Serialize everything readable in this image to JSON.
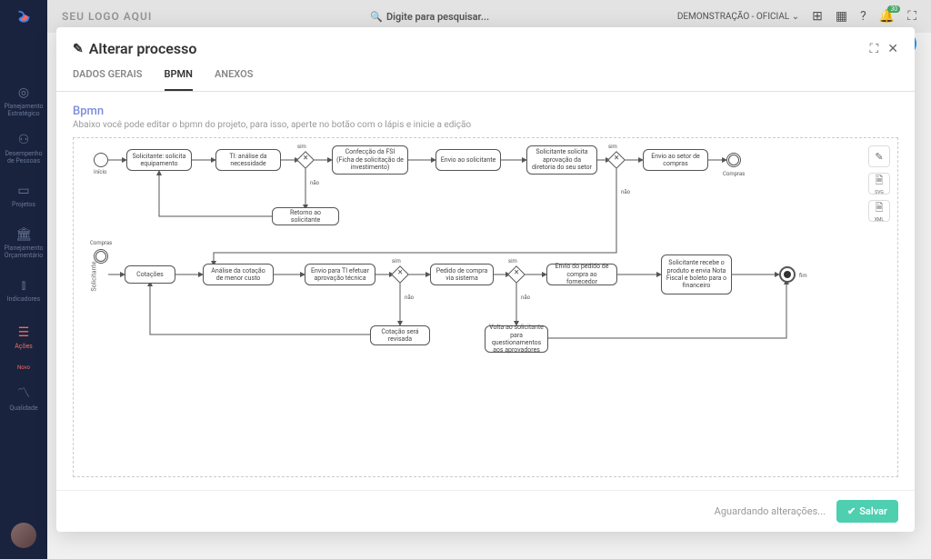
{
  "sidebar": {
    "items": [
      {
        "label": "Planejamento Estratégico"
      },
      {
        "label": "Desempenho de Pessoas"
      },
      {
        "label": "Projetos"
      },
      {
        "label": "Planejamento Orçamentário"
      },
      {
        "label": "Indicadores"
      },
      {
        "label": "Ações"
      },
      {
        "label": "Qualidade"
      }
    ],
    "new_badge": "Novo"
  },
  "header": {
    "logo": "SEU LOGO AQUI",
    "search_placeholder": "Digite para pesquisar...",
    "tenant": "DEMONSTRAÇÃO - OFICIAL",
    "notif_count": "30"
  },
  "modal": {
    "title": "Alterar processo",
    "tabs": [
      {
        "label": "DADOS GERAIS",
        "active": false
      },
      {
        "label": "BPMN",
        "active": true
      },
      {
        "label": "ANEXOS",
        "active": false
      }
    ],
    "section_title": "Bpmn",
    "section_subtitle": "Abaixo você pode editar o bpmn do projeto, para isso, aperte no botão com o lápis e inicie a edição",
    "footer_status": "Aguardando alterações...",
    "save_label": "Salvar",
    "tools": {
      "svg_label": "SVG",
      "xml_label": "XML"
    }
  },
  "bpmn": {
    "lane_label": "Solicitante",
    "start_label": "Início",
    "compras_label": "Compras",
    "end_label": "fim",
    "sim": "sim",
    "nao": "não",
    "nodes": {
      "n1": "Solicitante: solicita equipamento",
      "n2": "TI: análise da necessidade",
      "n3": "Confecção da FSI (Ficha de solicitação de investimento)",
      "n4": "Envio ao solicitante",
      "n5": "Solicitante solicita aprovação da diretoria do seu setor",
      "n6": "Envio ao setor de compras",
      "n7": "Retorno ao solicitante",
      "n8": "Cotações",
      "n9": "Análise da cotação de menor custo",
      "n10": "Envio para TI efetuar aprovação técnica",
      "n11": "Pedido de compra via sistema",
      "n12": "Envio do pedido de compra ao fornecedor",
      "n13": "Solicitante recebe o produto e envia Nota Fiscal e boleto para o financeiro",
      "n14": "Cotação será revisada",
      "n15": "Volta ao solicitante para questionamentos aos aprovadores"
    }
  }
}
